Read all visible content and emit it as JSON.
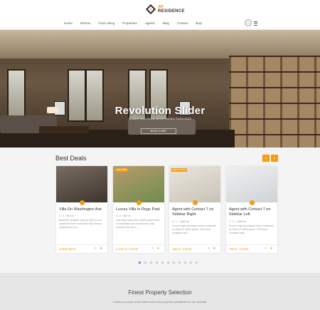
{
  "header": {
    "logo_top": "WP",
    "logo_bottom": "RESIDENCE",
    "nav": [
      "Home",
      "Demos",
      "Find Listing",
      "Properties",
      "Agents",
      "Blog",
      "Contact",
      "Buy!"
    ]
  },
  "hero": {
    "title": "Revolution Slider",
    "subtitle": "SLIDER INCLUDED WITH THEME PURCHASE",
    "button": "BOOK A VISIT"
  },
  "best_deals": {
    "title": "Best Deals",
    "prev": "‹",
    "next": "›",
    "cards": [
      {
        "title": "Villa On Washington Ave",
        "meta": "3 · 2 · 250 m²",
        "desc": "Beautiful, updated, ground level Co-op apartment in the desirable Bay Terrace neighborhood of...",
        "price": "5.500.000 €",
        "tag": "",
        "img_a": "#7a6d62",
        "img_b": "#3d352d",
        "fav": false
      },
      {
        "title": "Luxury Villa In Rego Park",
        "meta": "4 · 3 · 400 m²",
        "desc": "Just steps away from QM3 express bus to Manhattan and local buses; only minutes from the L...",
        "price": "2.100 € / month",
        "tag": "new offer",
        "img_a": "#b99b6d",
        "img_b": "#6f8c4e",
        "fav": true
      },
      {
        "title": "Agent with Contact 7 on Sidebar Right",
        "meta": "3 · 1 · 1.500 m²",
        "desc": "Former high end beach home converted to Class 'A' office space, 2475 sq ft complete with...",
        "price": "150 € / month",
        "tag": "open house",
        "img_a": "#e9e6df",
        "img_b": "#c9c2b6",
        "fav": false
      },
      {
        "title": "Agent with Contact 7 on Sidebar Left",
        "meta": "3 · 1 · 1.500 m²",
        "desc": "Former high end beach home converted to Class 'A' office space, 2475 sq ft complete with...",
        "price": "750 € / month",
        "tag": "",
        "img_a": "#f0f0f0",
        "img_b": "#cfd3d6",
        "fav": true
      }
    ]
  },
  "dots": {
    "count": 11,
    "active": 0
  },
  "finest": {
    "title": "Finest Property Selection",
    "subtitle": "Check out some of the latest and best properties published on our website."
  },
  "colors": {
    "accent": "#f39c12",
    "dot_active": "#3a8ee6"
  }
}
